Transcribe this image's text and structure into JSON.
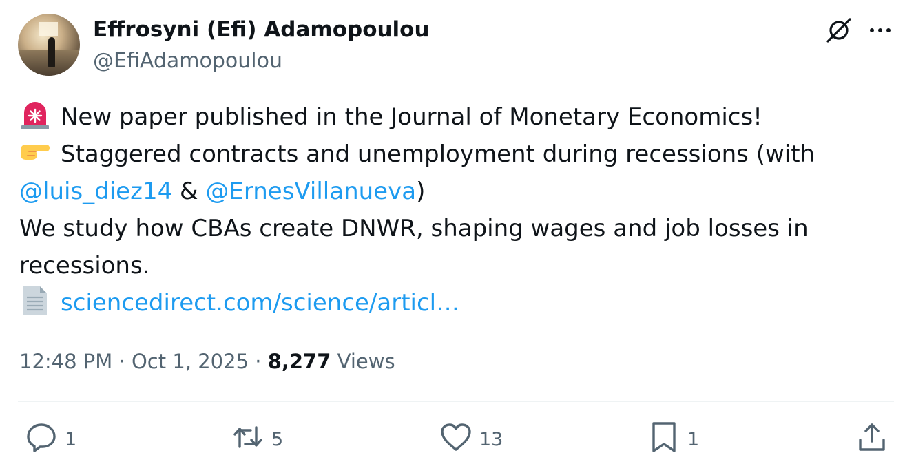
{
  "author": {
    "display_name": "Effrosyni (Efi) Adamopoulou",
    "handle": "@EfiAdamopoulou"
  },
  "tweet": {
    "line1_emoji": "rotating-light-emoji",
    "line1_text": "New paper published in the Journal of Monetary Economics!",
    "line2_emoji": "backhand-index-pointing-right-emoji",
    "line2_text": "Staggered contracts and unemployment during recessions (with",
    "mention1": "@luis_diez14",
    "amp": " & ",
    "mention2": "@ErnesVillanueva",
    "close_paren": ")",
    "line4_text": "We study how CBAs create DNWR, shaping wages and job losses in",
    "line5_text": "recessions.",
    "line6_emoji": "page-facing-up-emoji",
    "link_text": "sciencedirect.com/science/articl…"
  },
  "meta": {
    "time": "12:48 PM",
    "separator": " · ",
    "date": "Oct 1, 2025",
    "views_count": "8,277",
    "views_label": "Views"
  },
  "actions": {
    "reply_count": "1",
    "repost_count": "5",
    "like_count": "13",
    "bookmark_count": "1"
  },
  "colors": {
    "accent": "#1d9bf0",
    "secondary_text": "#536471",
    "primary_text": "#0f1419"
  }
}
